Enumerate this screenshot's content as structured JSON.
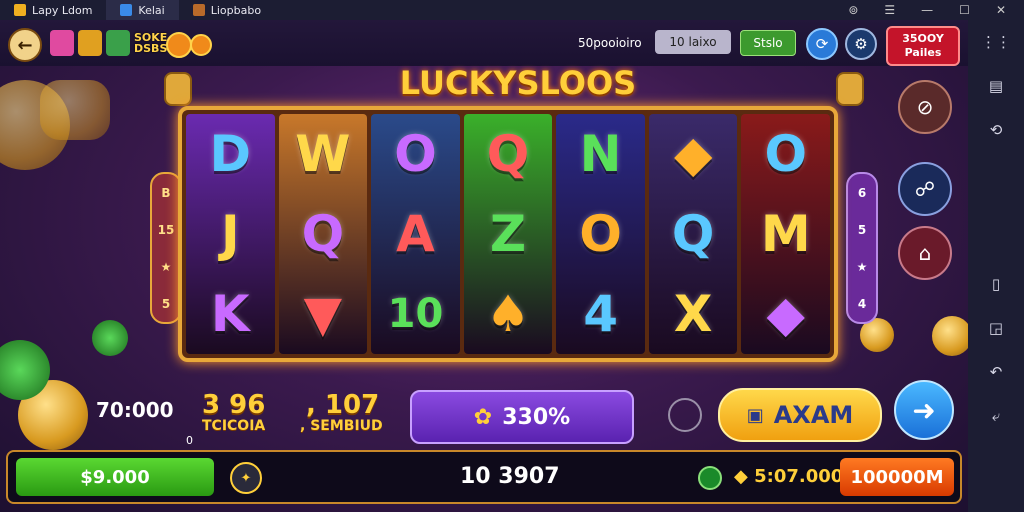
{
  "titlebar": {
    "tabs": [
      {
        "label": "Lapy Ldom"
      },
      {
        "label": "Kelai"
      },
      {
        "label": "Liopbabo"
      }
    ],
    "controls": {
      "a": "⊚",
      "b": "☰",
      "c": "—",
      "d": "☐",
      "e": "✕"
    }
  },
  "topbar": {
    "brand": "SOKE\nDSBS",
    "stat": "50pooioiro",
    "pill1": "10 laixo",
    "pill2": "Stslo",
    "red_btn_top": "35OOY",
    "red_btn_bottom": "Pailes"
  },
  "game": {
    "title": "LUCKYSLOOS",
    "reels": [
      {
        "symbols": [
          "D",
          "J",
          "K"
        ],
        "color": "#6a2ab0"
      },
      {
        "symbols": [
          "W",
          "Q",
          "▼"
        ],
        "color": "#c8782a"
      },
      {
        "symbols": [
          "O",
          "A",
          "10"
        ],
        "color": "#2a4a8a"
      },
      {
        "symbols": [
          "Q",
          "Z",
          "♠"
        ],
        "color": "#3ab02a"
      },
      {
        "symbols": [
          "N",
          "O",
          "4"
        ],
        "color": "#2a2a8a"
      },
      {
        "symbols": [
          "◆",
          "Q",
          "X"
        ],
        "color": "#3a2a6a"
      },
      {
        "symbols": [
          "O",
          "M",
          "◆"
        ],
        "color": "#8a1a1a"
      }
    ],
    "left_indicators": [
      "B",
      "15",
      "★",
      "5"
    ],
    "right_indicators": [
      "6",
      "5",
      "★",
      "4"
    ]
  },
  "info": {
    "bet_total": "70:000",
    "bet_sub": "0",
    "gold1": "3 96",
    "gold1_sub": "TCICOIA",
    "gold2": ", 107",
    "gold2_sub": ", SEMBIUD",
    "bet_button": "330%",
    "spin_label": "AXAM"
  },
  "bottom": {
    "balance": "$9.000",
    "middle": "10 3907",
    "win": "5:07.000",
    "win_button": "100000M"
  },
  "sidebar_icons": [
    "grid-icon",
    "folder-icon",
    "refresh-icon",
    "window-icon",
    "window-small-icon",
    "back-icon",
    "return-icon"
  ]
}
